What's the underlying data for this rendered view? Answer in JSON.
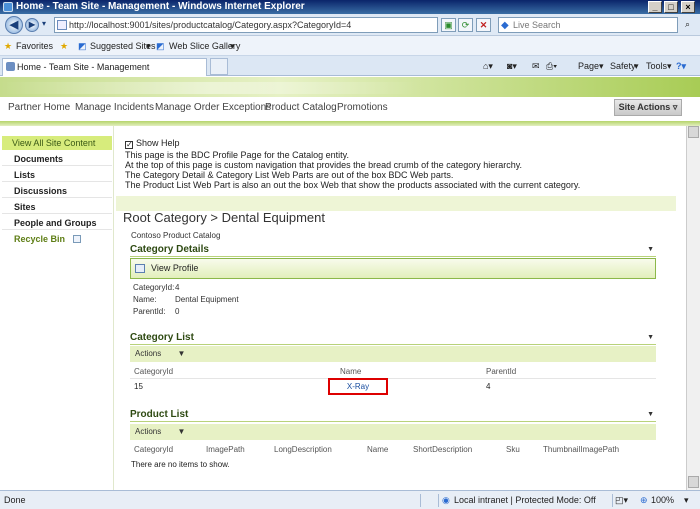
{
  "window": {
    "title": "Home - Team Site - Management - Windows Internet Explorer"
  },
  "browser": {
    "address": "http://localhost:9001/sites/productcatalog/Category.aspx?CategoryId=4",
    "search_placeholder": "Live Search",
    "favorites_label": "Favorites",
    "suggested_sites": "Suggested Sites",
    "web_slice_gallery": "Web Slice Gallery",
    "tab_title": "Home - Team Site - Management",
    "commands": {
      "page": "Page",
      "safety": "Safety",
      "tools": "Tools"
    }
  },
  "topnav": {
    "items": [
      "Partner Home",
      "Manage Incidents",
      "Manage Order Exceptions",
      "Product Catalog",
      "Promotions"
    ],
    "site_actions": "Site Actions"
  },
  "quicklaunch": {
    "view_all": "View All Site Content",
    "items": [
      "Documents",
      "Lists",
      "Discussions",
      "Sites",
      "People and Groups"
    ],
    "recycle_bin": "Recycle Bin"
  },
  "help": {
    "show_help": "Show Help",
    "lines": [
      "This page is the BDC Profile Page for the Catalog entity.",
      "At the top of this page is custom navigation that provides the bread crumb of the category hierarchy.",
      "The Category Detail & Category List Web Parts are out of the box BDC Web parts.",
      "The Product List Web Part is also an out the box Web that show the products associated with the current category."
    ]
  },
  "breadcrumb": "Root Category > Dental Equipment",
  "catalog_name": "Contoso Product Catalog",
  "category_details": {
    "title": "Category Details",
    "view_profile": "View Profile",
    "fields": [
      {
        "label": "CategoryId:",
        "value": "4"
      },
      {
        "label": "Name:",
        "value": "Dental Equipment"
      },
      {
        "label": "ParentId:",
        "value": "0"
      }
    ]
  },
  "category_list": {
    "title": "Category List",
    "actions": "Actions",
    "columns": [
      "CategoryId",
      "Name",
      "ParentId"
    ],
    "rows": [
      {
        "CategoryId": "15",
        "Name": "X-Ray",
        "ParentId": "4"
      }
    ]
  },
  "product_list": {
    "title": "Product List",
    "actions": "Actions",
    "columns": [
      "CategoryId",
      "ImagePath",
      "LongDescription",
      "Name",
      "ShortDescription",
      "Sku",
      "ThumbnailImagePath"
    ],
    "empty": "There are no items to show."
  },
  "status": {
    "left": "Done",
    "zone": "Local intranet | Protected Mode: Off",
    "zoom": "100%"
  }
}
